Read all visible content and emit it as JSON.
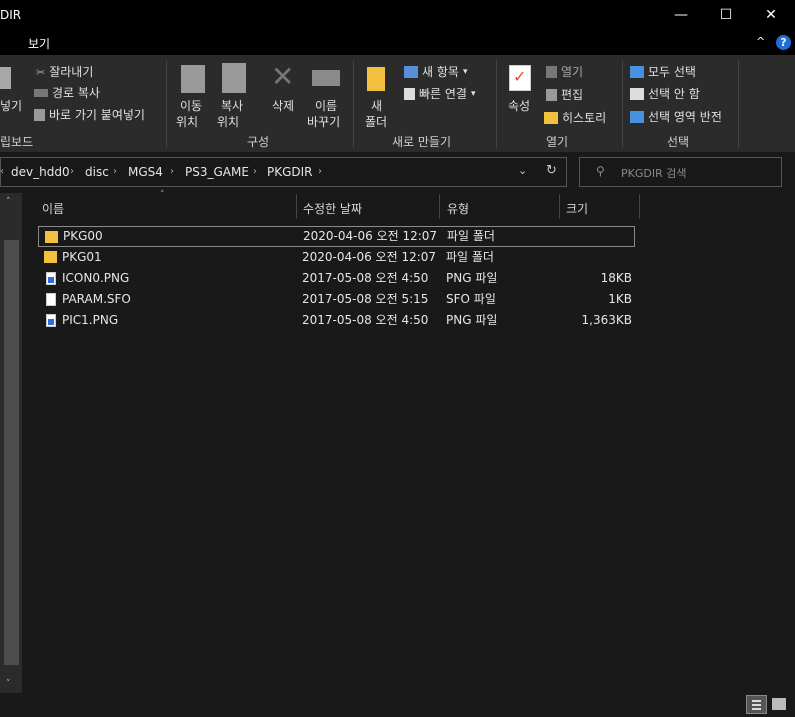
{
  "window": {
    "title": "DIR",
    "minimize": "—",
    "maximize": "☐",
    "close": "✕"
  },
  "ribbon": {
    "tab_view": "보기",
    "collapse_glyph": "^",
    "help_glyph": "?",
    "clipboard": {
      "paste": "넣기",
      "cut": "잘라내기",
      "copy_path": "경로 복사",
      "paste_shortcut": "바로 가기 붙여넣기",
      "group": "립보드"
    },
    "organize": {
      "move_to_1": "이동",
      "move_to_2": "위치",
      "copy_to_1": "복사",
      "copy_to_2": "위치",
      "delete": "삭제",
      "rename_1": "이름",
      "rename_2": "바꾸기",
      "group": "구성"
    },
    "new": {
      "new_folder_1": "새",
      "new_folder_2": "폴더",
      "new_item": "새 항목",
      "easy_access": "빠른 연결",
      "group": "새로 만들기"
    },
    "open": {
      "properties": "속성",
      "open": "열기",
      "edit": "편집",
      "history": "히스토리",
      "group": "열기"
    },
    "select": {
      "select_all": "모두 선택",
      "select_none": "선택 안 함",
      "invert": "선택 영역 반전",
      "group": "선택"
    }
  },
  "address": {
    "crumbs": [
      "dev_hdd0",
      "disc",
      "MGS4",
      "PS3_GAME",
      "PKGDIR"
    ],
    "search_placeholder": "PKGDIR 검색"
  },
  "columns": {
    "name": "이름",
    "modified": "수정한 날짜",
    "type": "유형",
    "size": "크기"
  },
  "files": [
    {
      "name": "PKG00",
      "modified": "2020-04-06 오전 12:07",
      "type": "파일 폴더",
      "size": "",
      "icon": "folder-icon"
    },
    {
      "name": "PKG01",
      "modified": "2020-04-06 오전 12:07",
      "type": "파일 폴더",
      "size": "",
      "icon": "folder-icon"
    },
    {
      "name": "ICON0.PNG",
      "modified": "2017-05-08 오전 4:50",
      "type": "PNG 파일",
      "size": "18KB",
      "icon": "png-file-icon"
    },
    {
      "name": "PARAM.SFO",
      "modified": "2017-05-08 오전 5:15",
      "type": "SFO 파일",
      "size": "1KB",
      "icon": "file-icon"
    },
    {
      "name": "PIC1.PNG",
      "modified": "2017-05-08 오전 4:50",
      "type": "PNG 파일",
      "size": "1,363KB",
      "icon": "png-file-icon"
    }
  ]
}
